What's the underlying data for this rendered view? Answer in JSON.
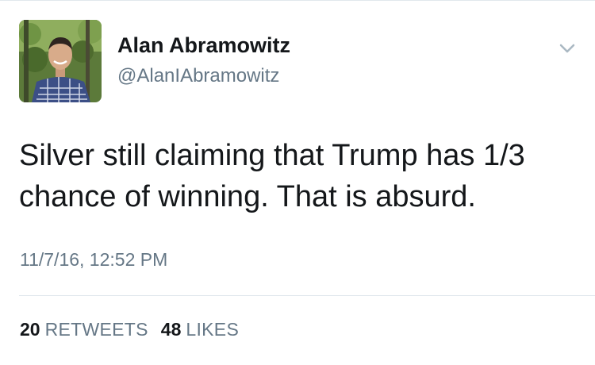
{
  "author": {
    "name": "Alan Abramowitz",
    "handle": "@AlanIAbramowitz"
  },
  "tweet": {
    "text": "Silver still claiming that Trump has 1/3 chance of winning. That is absurd.",
    "timestamp": "11/7/16, 12:52 PM"
  },
  "stats": {
    "retweets_count": "20",
    "retweets_label": "RETWEETS",
    "likes_count": "48",
    "likes_label": "LIKES"
  },
  "colors": {
    "text_primary": "#14171a",
    "text_secondary": "#657786",
    "divider": "#e1e8ed",
    "chevron": "#aab8c2"
  },
  "icons": {
    "menu": "chevron-down-icon"
  }
}
